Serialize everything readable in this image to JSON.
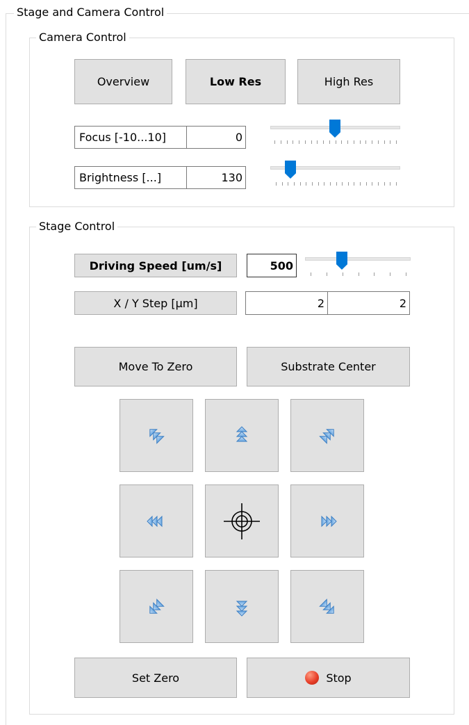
{
  "main_group": {
    "title": "Stage and Camera Control"
  },
  "camera": {
    "title": "Camera Control",
    "buttons": {
      "overview": "Overview",
      "low_res": "Low Res",
      "high_res": "High Res"
    },
    "focus": {
      "label": "Focus [-10...10]",
      "value": "0",
      "min": -10,
      "max": 10,
      "level": 0
    },
    "brightness": {
      "label": "Brightness [...]",
      "value": "130",
      "level": 130
    }
  },
  "stage": {
    "title": "Stage Control",
    "driving_speed": {
      "label": "Driving Speed [um/s]",
      "value": "500"
    },
    "xy_step": {
      "label": "X / Y Step [µm]",
      "x": "2",
      "y": "2"
    },
    "buttons": {
      "move_to_zero": "Move To Zero",
      "substrate_center": "Substrate Center",
      "set_zero": "Set Zero",
      "stop": "Stop"
    }
  },
  "colors": {
    "accent": "#0078d7",
    "button_bg": "#e1e1e1",
    "stop_red": "#e8402a",
    "arrow_blue": "#5b9bd5"
  }
}
